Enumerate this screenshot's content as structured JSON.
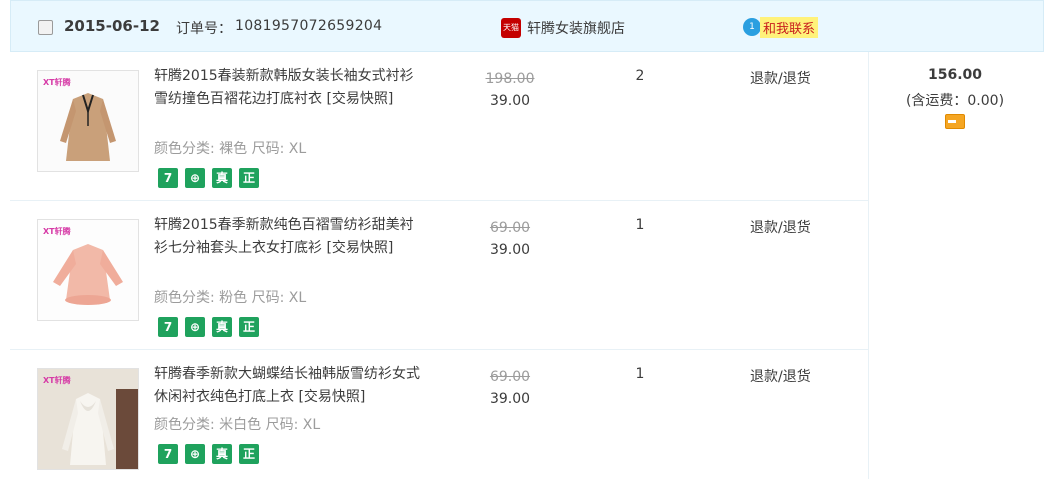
{
  "order": {
    "date": "2015-06-12",
    "order_label": "订单号：",
    "order_number": "1081957072659204",
    "shop_icon_text": "天猫",
    "shop_name": "轩腾女装旗舰店",
    "contact_badge": "1",
    "contact_label": "和我联系",
    "total": "156.00",
    "shipping": "(含运费：0.00)"
  },
  "items": [
    {
      "title": "轩腾2015春装新款韩版女装长袖女式衬衫雪纺撞色百褶花边打底衬衣 [交易快照]",
      "spec": "颜色分类: 裸色  尺码: XL",
      "old_price": "198.00",
      "price": "39.00",
      "qty": "2",
      "refund": "退款/退货",
      "thumb_logo": "XT轩腾",
      "badges": [
        "7",
        "⊕",
        "真",
        "正"
      ]
    },
    {
      "title": "轩腾2015春季新款纯色百褶雪纺衫甜美衬衫七分袖套头上衣女打底衫 [交易快照]",
      "spec": "颜色分类: 粉色  尺码: XL",
      "old_price": "69.00",
      "price": "39.00",
      "qty": "1",
      "refund": "退款/退货",
      "thumb_logo": "XT轩腾",
      "badges": [
        "7",
        "⊕",
        "真",
        "正"
      ]
    },
    {
      "title": "轩腾春季新款大蝴蝶结长袖韩版雪纺衫女式休闲衬衣纯色打底上衣 [交易快照]",
      "spec": "颜色分类: 米白色  尺码: XL",
      "old_price": "69.00",
      "price": "39.00",
      "qty": "1",
      "refund": "退款/退货",
      "thumb_logo": "XT轩腾",
      "badges": [
        "7",
        "⊕",
        "真",
        "正"
      ]
    }
  ],
  "colors": {
    "header_bg": "#eaf8ff",
    "badge_green": "#1fa25d",
    "contact_bg": "#fff27a",
    "shop_red": "#c40000"
  }
}
